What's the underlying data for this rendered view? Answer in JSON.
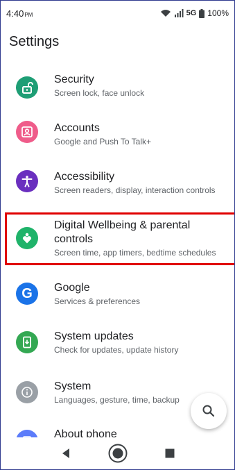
{
  "status_bar": {
    "time": "4:40",
    "ampm": "PM",
    "network": "5G",
    "battery": "100%"
  },
  "header": {
    "title": "Settings"
  },
  "items": [
    {
      "title": "Security",
      "summary": "Screen lock, face unlock",
      "icon": "lock-icon",
      "color": "#1e9e75"
    },
    {
      "title": "Accounts",
      "summary": "Google and Push To Talk+",
      "icon": "account-icon",
      "color": "#ef5c8a"
    },
    {
      "title": "Accessibility",
      "summary": "Screen readers, display, interaction controls",
      "icon": "accessibility-icon",
      "color": "#6a2fbf"
    },
    {
      "title": "Digital Wellbeing & parental controls",
      "summary": "Screen time, app timers, bedtime schedules",
      "icon": "wellbeing-heart-icon",
      "color": "#1fb36a",
      "highlighted": true
    },
    {
      "title": "Google",
      "summary": "Services & preferences",
      "icon": "google-icon",
      "color": "#1a73e8"
    },
    {
      "title": "System updates",
      "summary": "Check for updates, update history",
      "icon": "system-update-icon",
      "color": "#34a853"
    },
    {
      "title": "System",
      "summary": "Languages, gesture, time, backup",
      "icon": "info-icon",
      "color": "#9aa0a6"
    },
    {
      "title": "About phone",
      "summary": "",
      "icon": "about-phone-icon",
      "color": "#5c7cfa"
    }
  ],
  "fab": {
    "icon": "search-icon"
  },
  "nav": {
    "back": "back-icon",
    "home": "home-icon",
    "recents": "recents-icon"
  }
}
